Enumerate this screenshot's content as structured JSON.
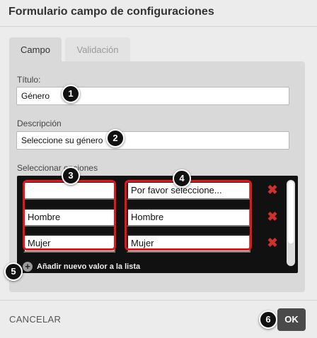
{
  "dialog": {
    "title": "Formulario campo de configuraciones"
  },
  "tabs": [
    {
      "label": "Campo",
      "active": true
    },
    {
      "label": "Validación",
      "active": false
    }
  ],
  "fields": {
    "titulo_label": "Título:",
    "titulo_value": "Género",
    "descripcion_label": "Descripción",
    "descripcion_value": "Seleccione su género",
    "opciones_label": "Seleccionar opciones"
  },
  "options": [
    {
      "value": "",
      "label": "Por favor seleccione..."
    },
    {
      "value": "Hombre",
      "label": "Hombre"
    },
    {
      "value": "Mujer",
      "label": "Mujer"
    }
  ],
  "add_option_label": "Añadir nuevo valor a la lista",
  "badges": [
    "1",
    "2",
    "3",
    "4",
    "5",
    "6"
  ],
  "footer": {
    "cancel_label": "CANCELAR",
    "ok_label": "OK"
  },
  "colors": {
    "delete": "#d2312a",
    "highlight": "#e8141b",
    "ok_button": "#4a4a4a"
  }
}
